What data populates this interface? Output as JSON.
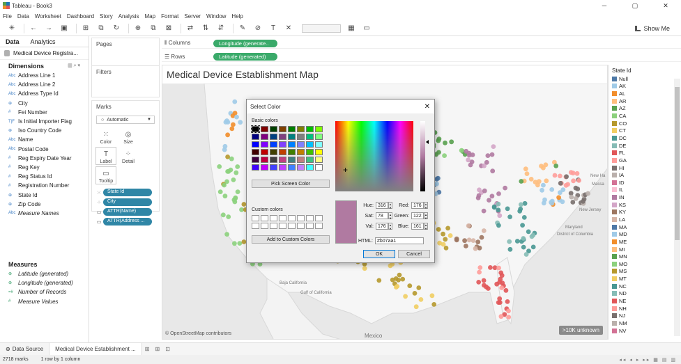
{
  "window": {
    "title": "Tableau - Book3",
    "controls": [
      "─",
      "▢",
      "✕"
    ]
  },
  "menu": [
    "File",
    "Data",
    "Worksheet",
    "Dashboard",
    "Story",
    "Analysis",
    "Map",
    "Format",
    "Server",
    "Window",
    "Help"
  ],
  "toolbar": {
    "show_me": "Show Me"
  },
  "data_pane": {
    "tabs": [
      "Data",
      "Analytics"
    ],
    "datasource": "Medical Device Registra...",
    "dimensions_label": "Dimensions",
    "dimensions": [
      {
        "type": "Abc",
        "name": "Address Line 1"
      },
      {
        "type": "Abc",
        "name": "Address Line 2"
      },
      {
        "type": "Abc",
        "name": "Address Type Id"
      },
      {
        "type": "⊕",
        "name": "City"
      },
      {
        "type": "#",
        "name": "Fei Number"
      },
      {
        "type": "T|F",
        "name": "Is Initial Importer Flag"
      },
      {
        "type": "⊕",
        "name": "Iso Country Code"
      },
      {
        "type": "Abc",
        "name": "Name"
      },
      {
        "type": "Abc",
        "name": "Postal Code"
      },
      {
        "type": "#",
        "name": "Reg Expiry Date Year"
      },
      {
        "type": "#",
        "name": "Reg Key"
      },
      {
        "type": "#",
        "name": "Reg Status Id"
      },
      {
        "type": "#",
        "name": "Registration Number"
      },
      {
        "type": "⊕",
        "name": "State Id"
      },
      {
        "type": "⊕",
        "name": "Zip Code"
      },
      {
        "type": "Abc",
        "name": "Measure Names"
      }
    ],
    "measures_label": "Measures",
    "measures": [
      {
        "type": "⊕",
        "name": "Latitude (generated)"
      },
      {
        "type": "⊕",
        "name": "Longitude (generated)"
      },
      {
        "type": "=#",
        "name": "Number of Records"
      },
      {
        "type": "#",
        "name": "Measure Values"
      }
    ]
  },
  "cards": {
    "pages": "Pages",
    "filters": "Filters",
    "marks": "Marks",
    "mark_type": "Automatic",
    "mark_buttons": [
      "Color",
      "Size",
      "Label",
      "Detail",
      "Tooltip"
    ],
    "mark_pills": [
      "State Id",
      "City",
      "ATTR(Name)",
      "ATTR(Address ..."
    ]
  },
  "shelves": {
    "columns_label": "Columns",
    "columns_pill": "Longitude (generate..",
    "rows_label": "Rows",
    "rows_pill": "Latitude (generated)"
  },
  "view": {
    "title": "Medical Device Establishment Map",
    "attribution": "© OpenStreetMap contributors",
    "unknown_badge": ">10K unknown",
    "map_labels": [
      "Baja California",
      "Gulf of California",
      "Mexico",
      "New Jersey",
      "Maryland",
      "District of Columbia",
      "New Ha",
      "Massa"
    ]
  },
  "legend": {
    "title": "State Id",
    "items": [
      {
        "label": "Null",
        "color": "#4e79a7"
      },
      {
        "label": "AK",
        "color": "#a0cbe8"
      },
      {
        "label": "AL",
        "color": "#f28e2b"
      },
      {
        "label": "AR",
        "color": "#ffbe7d"
      },
      {
        "label": "AZ",
        "color": "#59a14f"
      },
      {
        "label": "CA",
        "color": "#8cd17d"
      },
      {
        "label": "CO",
        "color": "#b6992d"
      },
      {
        "label": "CT",
        "color": "#f1ce63"
      },
      {
        "label": "DC",
        "color": "#499894"
      },
      {
        "label": "DE",
        "color": "#86bcb6"
      },
      {
        "label": "FL",
        "color": "#e15759"
      },
      {
        "label": "GA",
        "color": "#ff9d9a"
      },
      {
        "label": "HI",
        "color": "#79706e"
      },
      {
        "label": "IA",
        "color": "#bab0ac"
      },
      {
        "label": "ID",
        "color": "#d37295"
      },
      {
        "label": "IL",
        "color": "#fabfd2"
      },
      {
        "label": "IN",
        "color": "#b07aa1"
      },
      {
        "label": "KS",
        "color": "#d4a6c8"
      },
      {
        "label": "KY",
        "color": "#9d7660"
      },
      {
        "label": "LA",
        "color": "#d7b5a6"
      },
      {
        "label": "MA",
        "color": "#4e79a7"
      },
      {
        "label": "MD",
        "color": "#a0cbe8"
      },
      {
        "label": "ME",
        "color": "#f28e2b"
      },
      {
        "label": "MI",
        "color": "#ffbe7d"
      },
      {
        "label": "MN",
        "color": "#59a14f"
      },
      {
        "label": "MO",
        "color": "#8cd17d"
      },
      {
        "label": "MS",
        "color": "#b6992d"
      },
      {
        "label": "MT",
        "color": "#f1ce63"
      },
      {
        "label": "NC",
        "color": "#499894"
      },
      {
        "label": "ND",
        "color": "#86bcb6"
      },
      {
        "label": "NE",
        "color": "#e15759"
      },
      {
        "label": "NH",
        "color": "#ff9d9a"
      },
      {
        "label": "NJ",
        "color": "#79706e"
      },
      {
        "label": "NM",
        "color": "#bab0ac"
      },
      {
        "label": "NV",
        "color": "#d37295"
      }
    ]
  },
  "color_dialog": {
    "title": "Select Color",
    "basic_colors_label": "Basic colors",
    "basic_colors": [
      "#000000",
      "#800000",
      "#004000",
      "#804000",
      "#008000",
      "#808000",
      "#00c000",
      "#80ff00",
      "#000080",
      "#800080",
      "#004080",
      "#804080",
      "#008080",
      "#808080",
      "#00c080",
      "#80ff80",
      "#0000ff",
      "#8000ff",
      "#0040ff",
      "#8040ff",
      "#0080ff",
      "#8080ff",
      "#00c0ff",
      "#80ffff",
      "#400000",
      "#c00000",
      "#404000",
      "#c04000",
      "#408000",
      "#c08000",
      "#40c000",
      "#ffff00",
      "#400040",
      "#c00040",
      "#404040",
      "#c04080",
      "#408080",
      "#c08080",
      "#40c080",
      "#ffff80",
      "#4000ff",
      "#c000ff",
      "#4040ff",
      "#c040ff",
      "#4080ff",
      "#c080ff",
      "#40ffff",
      "#ffffff"
    ],
    "pick_screen_label": "Pick Screen Color",
    "custom_colors_label": "Custom colors",
    "add_custom_label": "Add to Custom Colors",
    "hue_label": "Hue:",
    "hue": "316",
    "sat_label": "Sat:",
    "sat": "78",
    "val_label": "Val:",
    "val": "176",
    "red_label": "Red:",
    "red": "176",
    "green_label": "Green:",
    "green": "122",
    "blue_label": "Blue:",
    "blue": "161",
    "html_label": "HTML:",
    "html": "#b07aa1",
    "ok_label": "OK",
    "cancel_label": "Cancel"
  },
  "sheet_tabs": {
    "datasource": "Data Source",
    "active": "Medical Device Establishment ..."
  },
  "status": {
    "marks": "2718 marks",
    "layout": "1 row by 1 column"
  }
}
